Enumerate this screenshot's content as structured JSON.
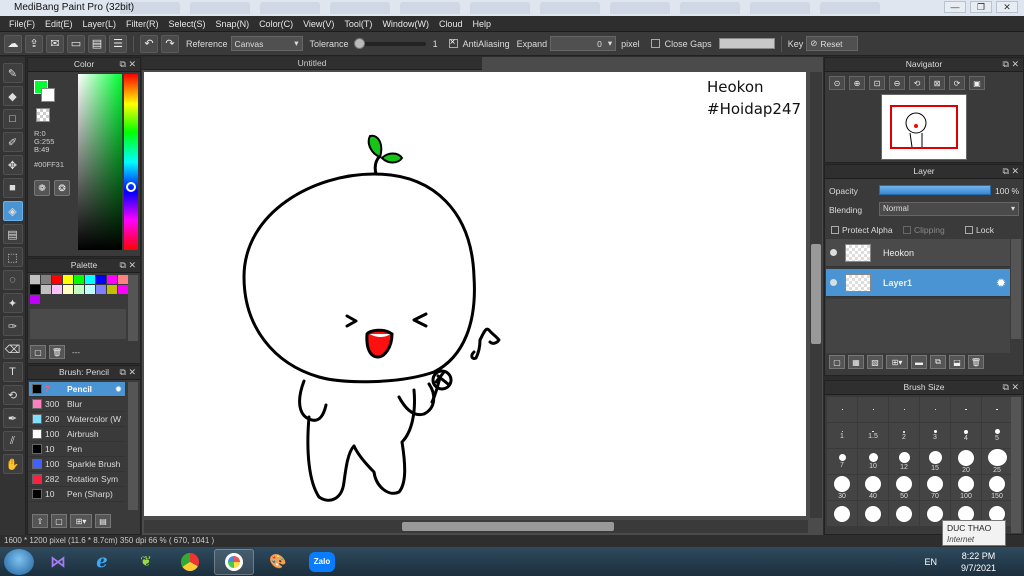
{
  "window": {
    "title": "MediBang Paint Pro (32bit)",
    "controls": [
      "—",
      "❐",
      "✕"
    ]
  },
  "menu": [
    "File(F)",
    "Edit(E)",
    "Layer(L)",
    "Filter(R)",
    "Select(S)",
    "Snap(N)",
    "Color(C)",
    "View(V)",
    "Tool(T)",
    "Window(W)",
    "Cloud",
    "Help"
  ],
  "toolbar": {
    "reference_label": "Reference",
    "reference_value": "Canvas",
    "tolerance_label": "Tolerance",
    "tolerance_value": "1",
    "antialias_label": "AntiAliasing",
    "expand_label": "Expand",
    "expand_value": "0",
    "expand_unit": "pixel",
    "close_gaps_label": "Close Gaps",
    "key_label": "Key",
    "reset_label": "Reset",
    "icons": [
      "cloud-icon",
      "export-icon",
      "comment-icon",
      "layout-icon",
      "document-icon",
      "checklist-icon",
      "undo-icon",
      "redo-icon",
      "reset-icon"
    ]
  },
  "tools": [
    {
      "name": "brush-tool",
      "glyph": "✎"
    },
    {
      "name": "eraser-tool",
      "glyph": "◆"
    },
    {
      "name": "rectangle-select-tool",
      "glyph": "□"
    },
    {
      "name": "lasso-brush-tool",
      "glyph": "✐"
    },
    {
      "name": "move-tool",
      "glyph": "✥"
    },
    {
      "name": "fill-rect-tool",
      "glyph": "■"
    },
    {
      "name": "bucket-tool",
      "glyph": "◈"
    },
    {
      "name": "gradient-tool",
      "glyph": "▤"
    },
    {
      "name": "select-tool",
      "glyph": "⬚"
    },
    {
      "name": "lasso-tool",
      "glyph": "◌"
    },
    {
      "name": "magic-wand-tool",
      "glyph": "✦"
    },
    {
      "name": "select-pen-tool",
      "glyph": "✑"
    },
    {
      "name": "select-eraser-tool",
      "glyph": "⌫"
    },
    {
      "name": "text-tool",
      "glyph": "T"
    },
    {
      "name": "operation-tool",
      "glyph": "⟲"
    },
    {
      "name": "eyedropper-tool",
      "glyph": "✒"
    },
    {
      "name": "divide-tool",
      "glyph": "⫽"
    },
    {
      "name": "hand-tool",
      "glyph": "✋"
    }
  ],
  "color_panel": {
    "title": "Color",
    "r": "R:0",
    "g": "G:255",
    "b": "B:49",
    "hex": "#00FF31",
    "fg": "#00FF31"
  },
  "palette_panel": {
    "title": "Palette",
    "colors": [
      "#c0c0c0",
      "#808080",
      "#ff0000",
      "#ffff00",
      "#00ff00",
      "#00ffff",
      "#0000ff",
      "#ff00ff",
      "#ff8080",
      "#000000",
      "#c0c0c0",
      "#ffc0ff",
      "#ffffc0",
      "#c0ffc0",
      "#c0ffff",
      "#8080ff",
      "#c0c000",
      "#ff00ff",
      "#c000ff"
    ],
    "footer_text": "---"
  },
  "brush_panel": {
    "title": "Brush: Pencil",
    "items": [
      {
        "size": "7",
        "name": "Pencil",
        "color": "#000000",
        "selected": true
      },
      {
        "size": "300",
        "name": "Blur",
        "color": "#ff80c0",
        "selected": false
      },
      {
        "size": "200",
        "name": "Watercolor (W",
        "color": "#80e0ff",
        "selected": false
      },
      {
        "size": "100",
        "name": "Airbrush",
        "color": "#ffffff",
        "selected": false
      },
      {
        "size": "10",
        "name": "Pen",
        "color": "#000000",
        "selected": false
      },
      {
        "size": "100",
        "name": "Sparkle Brush",
        "color": "#4060ff",
        "selected": false
      },
      {
        "size": "282",
        "name": "Rotation Sym",
        "color": "#ff2040",
        "selected": false
      },
      {
        "size": "10",
        "name": "Pen (Sharp)",
        "color": "#000000",
        "selected": false
      }
    ]
  },
  "document": {
    "tab": "Untitled",
    "canvas_text_1": "Heokon",
    "canvas_text_2": "#Hoidap247"
  },
  "navigator_panel": {
    "title": "Navigator"
  },
  "layer_panel": {
    "title": "Layer",
    "opacity_label": "Opacity",
    "opacity_value": "100 %",
    "opacity": 1.0,
    "blending_label": "Blending",
    "blending_value": "Normal",
    "protect_alpha": "Protect Alpha",
    "clipping": "Clipping",
    "lock": "Lock",
    "layers": [
      {
        "name": "Heokon",
        "selected": false
      },
      {
        "name": "Layer1",
        "selected": true
      }
    ]
  },
  "brushsize_panel": {
    "title": "Brush Size",
    "sizes": [
      "",
      "",
      "",
      "",
      "",
      "",
      "1",
      "1.5",
      "2",
      "3",
      "4",
      "5",
      "7",
      "10",
      "12",
      "15",
      "20",
      "25",
      "30",
      "40",
      "50",
      "70",
      "100",
      "150",
      "",
      "",
      "",
      "",
      "",
      ""
    ]
  },
  "status": {
    "text": "1600 * 1200 pixel   (11.6 * 8.7cm)   350 dpi   66 %   ( 670, 1041 )"
  },
  "taskbar": {
    "apps": [
      "visual-studio",
      "internet-explorer",
      "app-bird",
      "chrome",
      "medibang",
      "paint",
      "zalo"
    ],
    "zalo_label": "Zalo",
    "lang": "EN",
    "time": "8:22 PM",
    "date": "9/7/2021",
    "tooltip_title": "DUC THAO",
    "tooltip_sub": "Internet access"
  }
}
